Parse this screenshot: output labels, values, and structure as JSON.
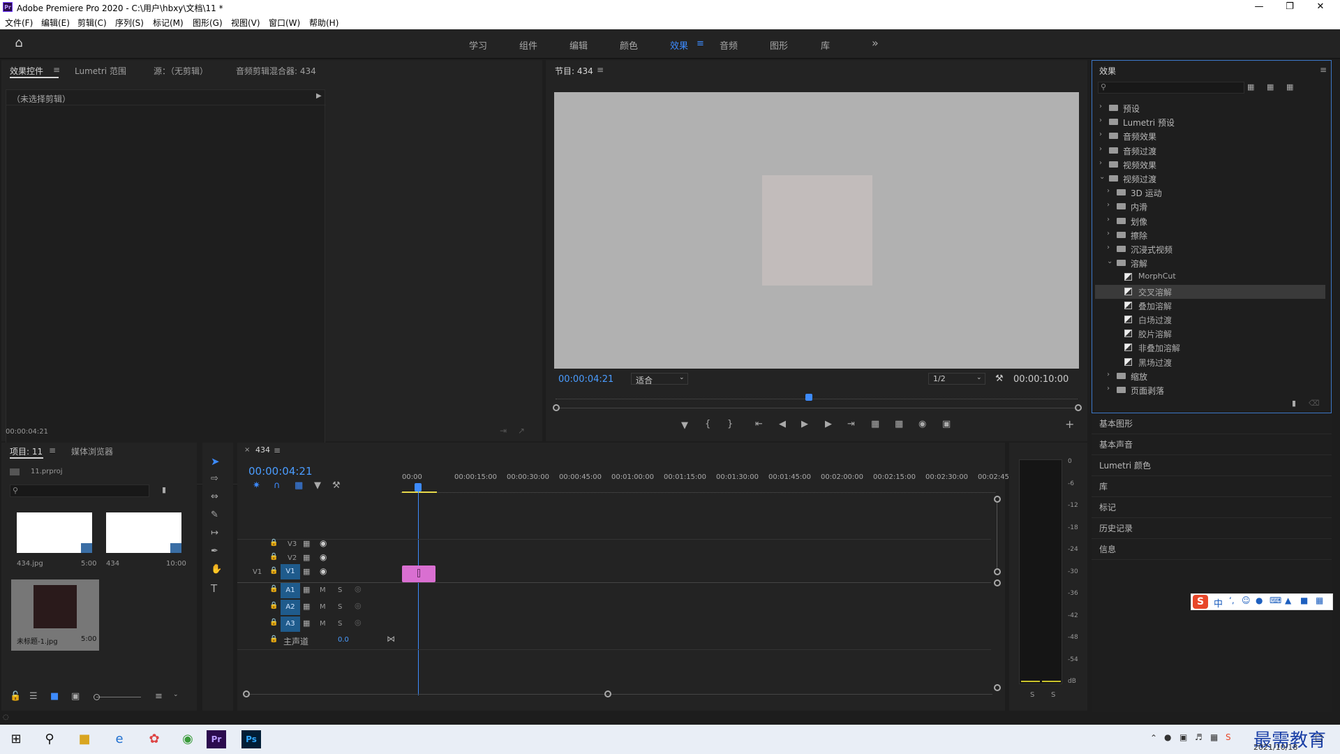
{
  "window": {
    "title": "Adobe Premiere Pro 2020 - C:\\用户\\hbxy\\文档\\11 *",
    "logo": "Pr"
  },
  "menu": [
    "文件(F)",
    "编辑(E)",
    "剪辑(C)",
    "序列(S)",
    "标记(M)",
    "图形(G)",
    "视图(V)",
    "窗口(W)",
    "帮助(H)"
  ],
  "workspaces": {
    "items": [
      "学习",
      "组件",
      "编辑",
      "颜色",
      "效果",
      "音频",
      "图形",
      "库"
    ],
    "active": "效果",
    "overflow": "»"
  },
  "source_panel": {
    "tabs": [
      "效果控件",
      "Lumetri 范围",
      "源：（无剪辑）",
      "音频剪辑混合器: 434"
    ],
    "no_clip": "（未选择剪辑）",
    "timecode": "00:00:04:21"
  },
  "program_monitor": {
    "title": "节目: 434",
    "timecode": "00:00:04:21",
    "fit": "适合",
    "resolution": "1/2",
    "duration": "00:00:10:00",
    "playhead_fraction": 0.485
  },
  "effects_panel": {
    "title": "效果",
    "tree": [
      {
        "label": "预设",
        "level": 0,
        "type": "folder",
        "expanded": false
      },
      {
        "label": "Lumetri 预设",
        "level": 0,
        "type": "folder",
        "expanded": false
      },
      {
        "label": "音频效果",
        "level": 0,
        "type": "folder",
        "expanded": false
      },
      {
        "label": "音频过渡",
        "level": 0,
        "type": "folder",
        "expanded": false
      },
      {
        "label": "视频效果",
        "level": 0,
        "type": "folder",
        "expanded": false
      },
      {
        "label": "视频过渡",
        "level": 0,
        "type": "folder",
        "expanded": true
      },
      {
        "label": "3D 运动",
        "level": 1,
        "type": "folder",
        "expanded": false
      },
      {
        "label": "内滑",
        "level": 1,
        "type": "folder",
        "expanded": false
      },
      {
        "label": "划像",
        "level": 1,
        "type": "folder",
        "expanded": false
      },
      {
        "label": "擦除",
        "level": 1,
        "type": "folder",
        "expanded": false
      },
      {
        "label": "沉浸式视频",
        "level": 1,
        "type": "folder",
        "expanded": false
      },
      {
        "label": "溶解",
        "level": 1,
        "type": "folder",
        "expanded": true
      },
      {
        "label": "MorphCut",
        "level": 2,
        "type": "effect"
      },
      {
        "label": "交叉溶解",
        "level": 2,
        "type": "effect",
        "selected": true
      },
      {
        "label": "叠加溶解",
        "level": 2,
        "type": "effect"
      },
      {
        "label": "白场过渡",
        "level": 2,
        "type": "effect"
      },
      {
        "label": "胶片溶解",
        "level": 2,
        "type": "effect"
      },
      {
        "label": "非叠加溶解",
        "level": 2,
        "type": "effect"
      },
      {
        "label": "黑场过渡",
        "level": 2,
        "type": "effect"
      },
      {
        "label": "缩放",
        "level": 1,
        "type": "folder",
        "expanded": false
      },
      {
        "label": "页面剥落",
        "level": 1,
        "type": "folder",
        "expanded": false
      }
    ]
  },
  "side_panels": [
    "基本图形",
    "基本声音",
    "Lumetri 颜色",
    "库",
    "标记",
    "历史记录",
    "信息"
  ],
  "project_panel": {
    "tabs": [
      "项目: 11",
      "媒体浏览器"
    ],
    "file": "11.prproj",
    "items": [
      {
        "name": "434.jpg",
        "duration": "5:00"
      },
      {
        "name": "434",
        "duration": "10:00"
      },
      {
        "name": "未标题-1.jpg",
        "duration": "5:00"
      }
    ]
  },
  "timeline": {
    "sequence": "434",
    "timecode": "00:00:04:21",
    "ruler": [
      "00:00",
      "00:00:15:00",
      "00:00:30:00",
      "00:00:45:00",
      "00:01:00:00",
      "00:01:15:00",
      "00:01:30:00",
      "00:01:45:00",
      "00:02:00:00",
      "00:02:15:00",
      "00:02:30:00",
      "00:02:45:"
    ],
    "tracks_video": [
      "V3",
      "V2",
      "V1"
    ],
    "tracks_audio": [
      "A1",
      "A2",
      "A3"
    ],
    "source_patch": "V1",
    "mute_label": "M",
    "solo_label": "S",
    "master_label": "主声道",
    "master_value": "0.0",
    "clip_color": "#d96fd1"
  },
  "audio_meter": {
    "scale": [
      "0",
      "-6",
      "-12",
      "-18",
      "-24",
      "-30",
      "-36",
      "-42",
      "-48",
      "-54",
      "dB"
    ],
    "solo": [
      "S",
      "S"
    ]
  },
  "taskbar": {
    "date": "2021/10/18",
    "watermark": "最需教育"
  },
  "ime": {
    "label": "中"
  },
  "colors": {
    "accent": "#3d8bff",
    "panel_bg": "#232323",
    "app_bg": "#1d1d1d",
    "clip": "#d96fd1"
  }
}
